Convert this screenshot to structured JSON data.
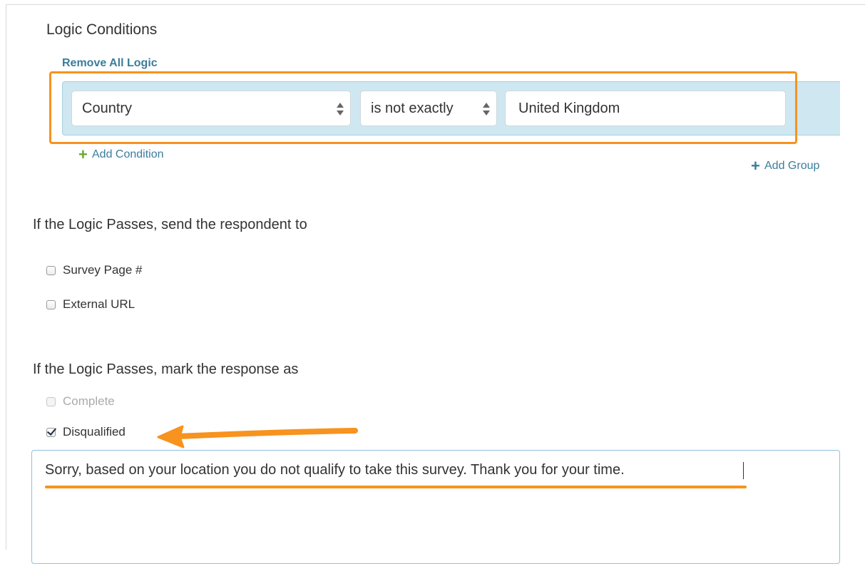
{
  "logic": {
    "title": "Logic Conditions",
    "remove_all": "Remove All Logic",
    "condition": {
      "field": "Country",
      "operator": "is not exactly",
      "value": "United Kingdom"
    },
    "add_condition": "Add Condition",
    "add_group": "Add Group"
  },
  "send_to": {
    "heading": "If the Logic Passes, send the respondent to",
    "options": [
      {
        "label": "Survey Page #",
        "checked": false
      },
      {
        "label": "External URL",
        "checked": false
      }
    ]
  },
  "mark_as": {
    "heading": "If the Logic Passes, mark the response as",
    "options": [
      {
        "label": "Complete",
        "checked": false,
        "disabled": true
      },
      {
        "label": "Disqualified",
        "checked": true,
        "disabled": false
      }
    ]
  },
  "message": {
    "text": "Sorry, based on your location you do not qualify to take this survey. Thank you for your time."
  },
  "colors": {
    "annotation": "#f7931e",
    "link": "#3a7d9c",
    "plus_green": "#6aa832",
    "group_bg": "#cfe7f1"
  },
  "icons": {
    "select_arrows": "up-down-arrows-icon",
    "plus": "plus-icon",
    "pointer_arrow": "annotation-arrow-icon"
  }
}
